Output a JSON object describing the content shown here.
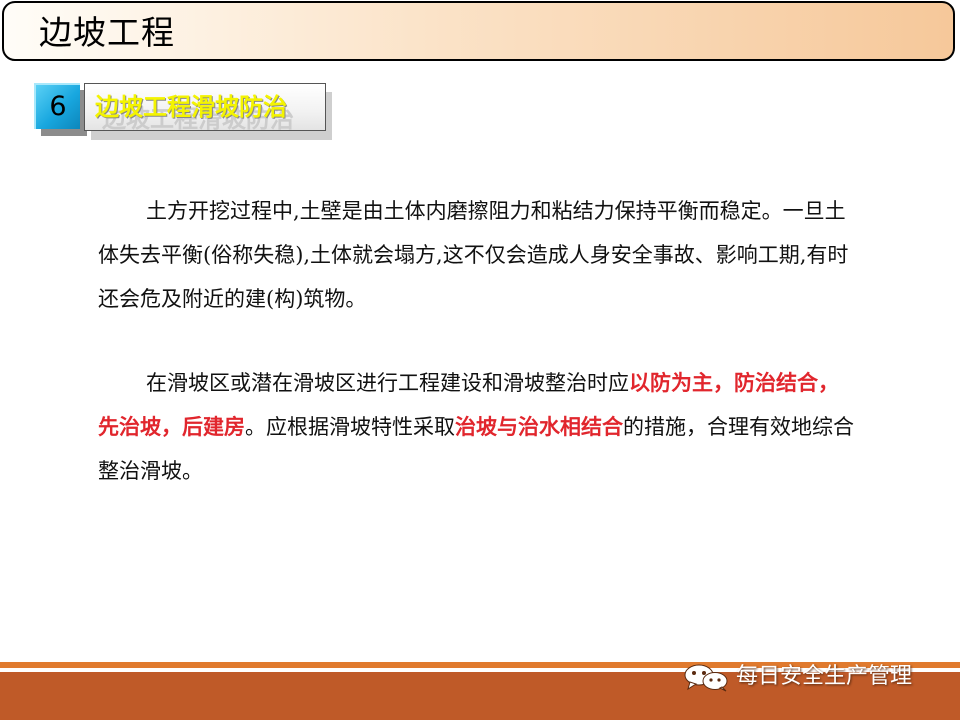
{
  "header": {
    "title": "边坡工程"
  },
  "section": {
    "number": "6",
    "title": "边坡工程滑坡防治"
  },
  "content": {
    "paragraph1": "土方开挖过程中,土壁是由土体内磨擦阻力和粘结力保持平衡而稳定。一旦土体失去平衡(俗称失稳),土体就会塌方,这不仅会造成人身安全事故、影响工期,有时还会危及附近的建(构)筑物。",
    "paragraph2": {
      "part1": "在滑坡区或潜在滑坡区进行工程建设和滑坡整治时应",
      "highlight1": "以防为主，防治结合，先治坡，后建房",
      "part2": "。应根据滑坡特性采取",
      "highlight2": "治坡与治水相结合",
      "part3": "的措施，合理有效地综合整治滑坡。"
    }
  },
  "footer": {
    "watermark": "每日安全生产管理",
    "icon": "wechat-icon"
  },
  "colors": {
    "highlight": "#e1262d",
    "section_title": "#f4f400",
    "badge": "#18a7df",
    "footer": "#bf5a28",
    "footer_line": "#e07a2e"
  }
}
